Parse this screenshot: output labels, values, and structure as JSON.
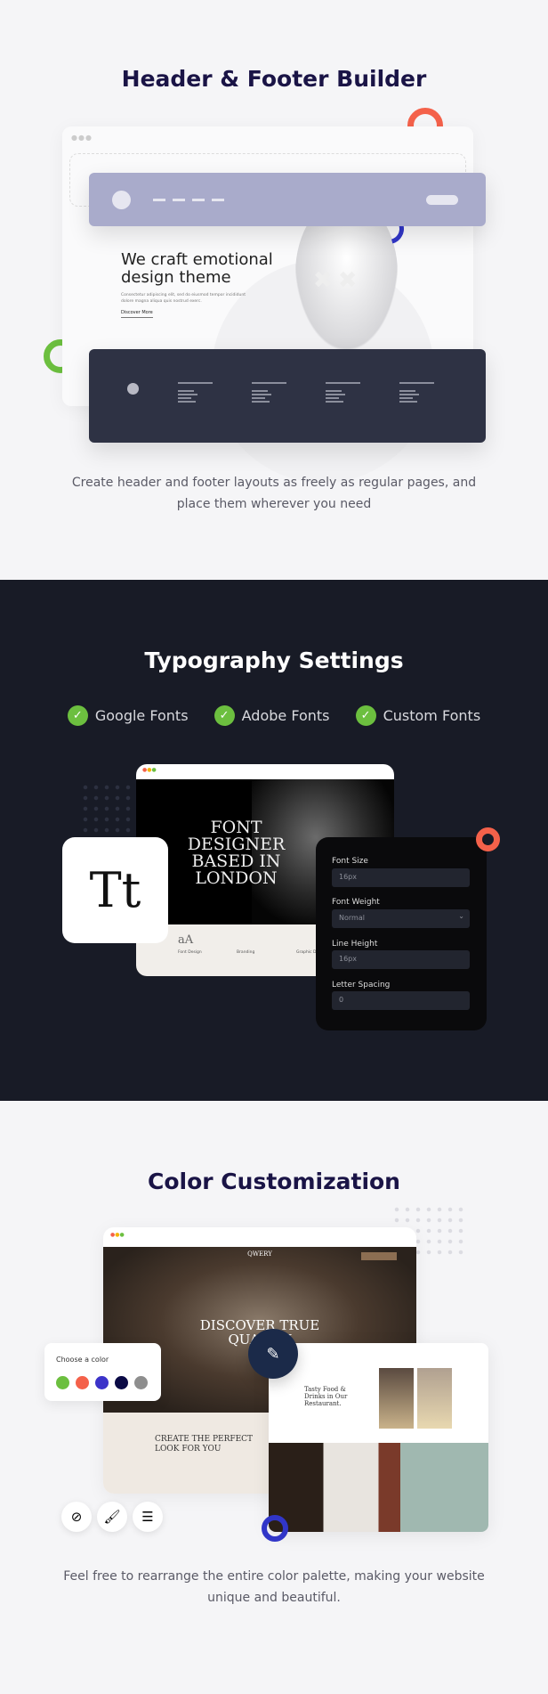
{
  "header_footer": {
    "title": "Header & Footer Builder",
    "hero_heading": "We craft emotional design theme",
    "hero_text": "Consectetur adipiscing elit, sed do eiusmod tempor incididunt dolore magna aliqua quis nostrud exerc.",
    "hero_link": "Discover More",
    "caption": "Create header and footer layouts as freely as regular pages, and place them wherever you need"
  },
  "typography": {
    "title": "Typography Settings",
    "features": [
      "Google Fonts",
      "Adobe Fonts",
      "Custom Fonts"
    ],
    "hero_text": "FONT DESIGNER BASED IN LONDON",
    "icon_label": "Tt",
    "services": [
      "Font Design",
      "Branding",
      "Graphic Design"
    ],
    "panel": {
      "font_size_label": "Font Size",
      "font_size": "16px",
      "font_weight_label": "Font Weight",
      "font_weight": "Normal",
      "line_height_label": "Line Height",
      "line_height": "16px",
      "letter_spacing_label": "Letter Spacing",
      "letter_spacing": "0"
    }
  },
  "color": {
    "title": "Color Customization",
    "logo": "QWERY",
    "hero_text": "DISCOVER TRUE QUALITY",
    "section_heading": "CREATE THE PERFECT LOOK FOR YOU",
    "card_heading": "Tasty Food & Drinks in Our Restaurant.",
    "picker_label": "Choose a color",
    "swatches": [
      "#6cbf3f",
      "#f4614a",
      "#3c33c9",
      "#0b0a45",
      "#8e8e8e"
    ],
    "caption": "Feel free to rearrange the entire color palette, making your website unique and beautiful."
  },
  "colors": {
    "navy": "#1a1446",
    "dark_bg": "#181b26",
    "lavender": "#a9abcb",
    "footer": "#2e3244",
    "red": "#f4614a",
    "green": "#6cbf3f",
    "blue": "#3136c8"
  }
}
